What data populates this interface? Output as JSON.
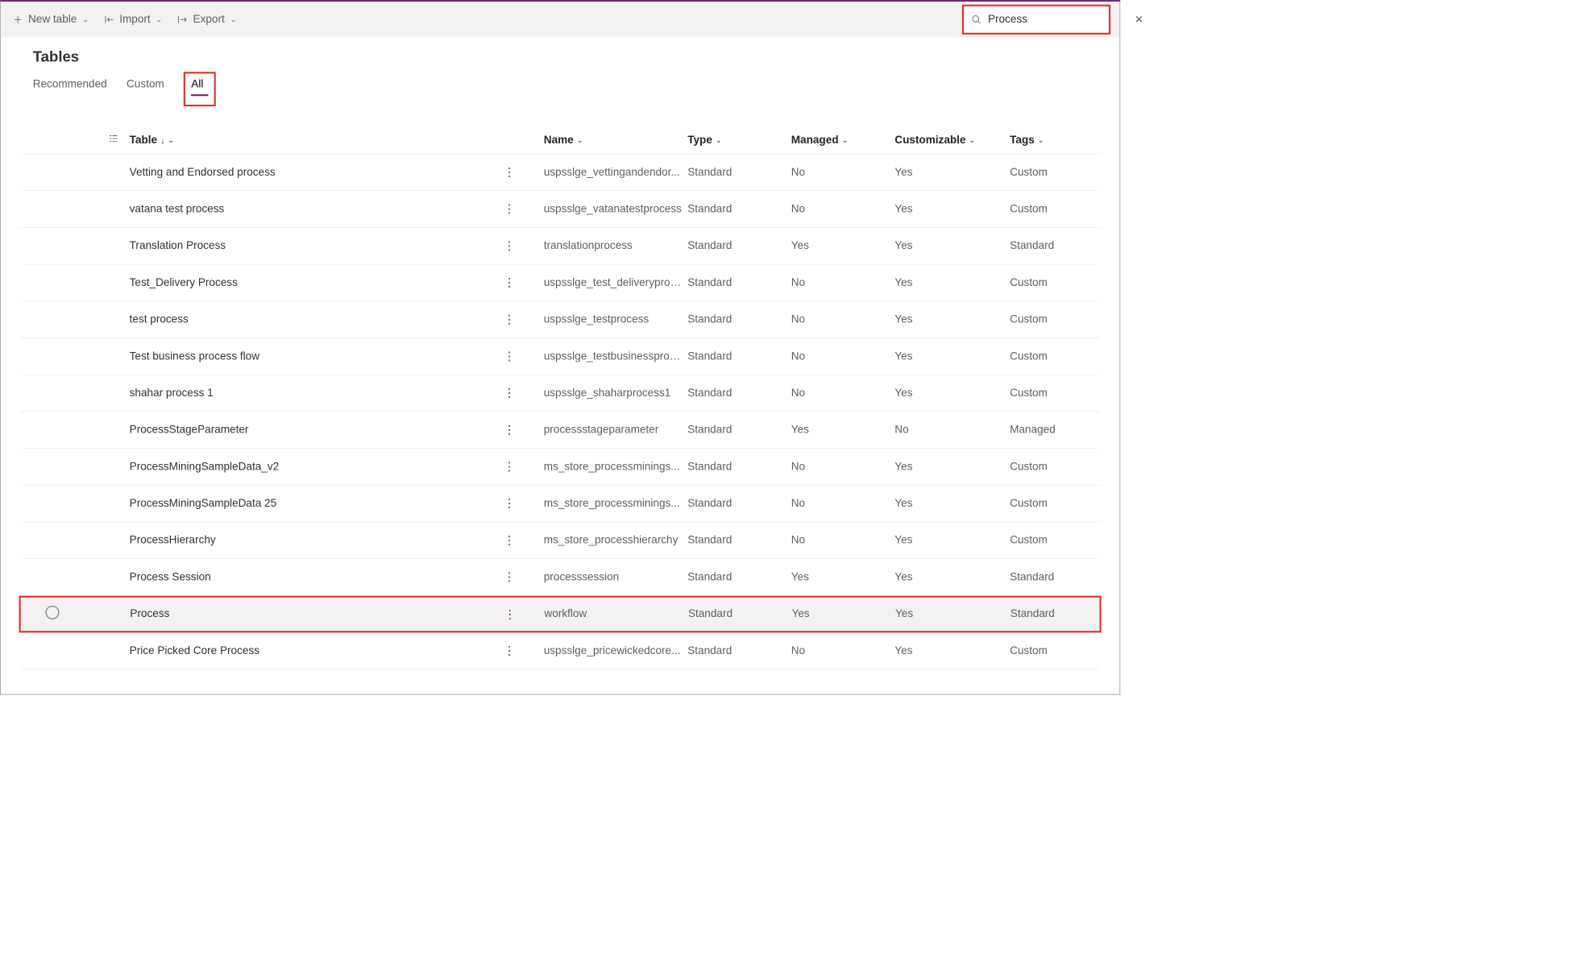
{
  "toolbar": {
    "new_table": "New table",
    "import": "Import",
    "export": "Export"
  },
  "search": {
    "value": "Process"
  },
  "page": {
    "title": "Tables"
  },
  "tabs": {
    "recommended": "Recommended",
    "custom": "Custom",
    "all": "All"
  },
  "columns": {
    "table": "Table",
    "name": "Name",
    "type": "Type",
    "managed": "Managed",
    "customizable": "Customizable",
    "tags": "Tags"
  },
  "rows": [
    {
      "table": "Vetting and Endorsed process",
      "name": "uspsslge_vettingandendor...",
      "type": "Standard",
      "managed": "No",
      "customizable": "Yes",
      "tags": "Custom"
    },
    {
      "table": "vatana test process",
      "name": "uspsslge_vatanatestprocess",
      "type": "Standard",
      "managed": "No",
      "customizable": "Yes",
      "tags": "Custom"
    },
    {
      "table": "Translation Process",
      "name": "translationprocess",
      "type": "Standard",
      "managed": "Yes",
      "customizable": "Yes",
      "tags": "Standard"
    },
    {
      "table": "Test_Delivery Process",
      "name": "uspsslge_test_deliveryproc...",
      "type": "Standard",
      "managed": "No",
      "customizable": "Yes",
      "tags": "Custom"
    },
    {
      "table": "test process",
      "name": "uspsslge_testprocess",
      "type": "Standard",
      "managed": "No",
      "customizable": "Yes",
      "tags": "Custom"
    },
    {
      "table": "Test business process flow",
      "name": "uspsslge_testbusinessproc...",
      "type": "Standard",
      "managed": "No",
      "customizable": "Yes",
      "tags": "Custom"
    },
    {
      "table": "shahar process 1",
      "name": "uspsslge_shaharprocess1",
      "type": "Standard",
      "managed": "No",
      "customizable": "Yes",
      "tags": "Custom"
    },
    {
      "table": "ProcessStageParameter",
      "name": "processstageparameter",
      "type": "Standard",
      "managed": "Yes",
      "customizable": "No",
      "tags": "Managed"
    },
    {
      "table": "ProcessMiningSampleData_v2",
      "name": "ms_store_processminings...",
      "type": "Standard",
      "managed": "No",
      "customizable": "Yes",
      "tags": "Custom"
    },
    {
      "table": "ProcessMiningSampleData 25",
      "name": "ms_store_processminings...",
      "type": "Standard",
      "managed": "No",
      "customizable": "Yes",
      "tags": "Custom"
    },
    {
      "table": "ProcessHierarchy",
      "name": "ms_store_processhierarchy",
      "type": "Standard",
      "managed": "No",
      "customizable": "Yes",
      "tags": "Custom"
    },
    {
      "table": "Process Session",
      "name": "processsession",
      "type": "Standard",
      "managed": "Yes",
      "customizable": "Yes",
      "tags": "Standard"
    },
    {
      "table": "Process",
      "name": "workflow",
      "type": "Standard",
      "managed": "Yes",
      "customizable": "Yes",
      "tags": "Standard",
      "highlighted": true
    },
    {
      "table": "Price Picked Core Process",
      "name": "uspsslge_pricewickedcore...",
      "type": "Standard",
      "managed": "No",
      "customizable": "Yes",
      "tags": "Custom"
    }
  ]
}
